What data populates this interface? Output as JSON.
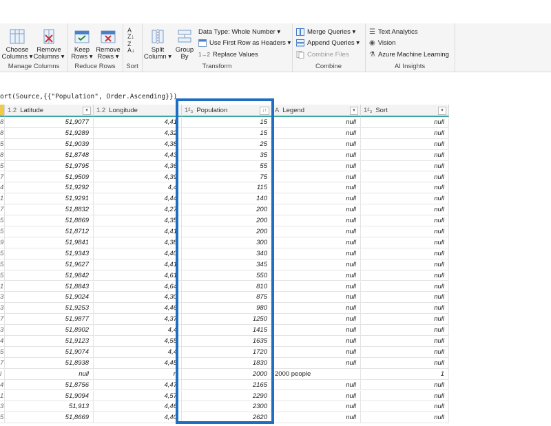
{
  "ribbon": {
    "manage_columns": {
      "label": "Manage Columns",
      "choose": [
        "Choose",
        "Columns ▾"
      ],
      "remove": [
        "Remove",
        "Columns ▾"
      ]
    },
    "reduce_rows": {
      "label": "Reduce Rows",
      "keep": [
        "Keep",
        "Rows ▾"
      ],
      "remove": [
        "Remove",
        "Rows ▾"
      ]
    },
    "sort": {
      "label": "Sort"
    },
    "transform": {
      "label": "Transform",
      "split": [
        "Split",
        "Column ▾"
      ],
      "group": [
        "Group",
        "By"
      ],
      "data_type": "Data Type: Whole Number ▾",
      "first_row": "Use First Row as Headers ▾",
      "replace": "Replace Values"
    },
    "combine": {
      "label": "Combine",
      "merge": "Merge Queries ▾",
      "append": "Append Queries ▾",
      "combine_files": "Combine Files"
    },
    "ai": {
      "label": "AI Insights",
      "text": "Text Analytics",
      "vision": "Vision",
      "azure": "Azure Machine Learning"
    }
  },
  "formula": "ort(Source,{{\"Population\", Order.Ascending}})",
  "columns": {
    "latitude": {
      "type": "1.2",
      "name": "Latitude"
    },
    "longitude": {
      "type": "1.2",
      "name": "Longitude"
    },
    "population": {
      "type": "1²₃",
      "name": "Population"
    },
    "legend": {
      "type": "A",
      "name": "Legend"
    },
    "sort": {
      "type": "1²₃",
      "name": "Sort"
    }
  },
  "rows": [
    {
      "idx": "8",
      "lat": "51,9077",
      "lon": "4,41",
      "pop": "15",
      "leg": "null",
      "sort": "null"
    },
    {
      "idx": "8",
      "lat": "51,9289",
      "lon": "4,32",
      "pop": "15",
      "leg": "null",
      "sort": "null"
    },
    {
      "idx": "5",
      "lat": "51,9039",
      "lon": "4,38",
      "pop": "25",
      "leg": "null",
      "sort": "null"
    },
    {
      "idx": "8",
      "lat": "51,8748",
      "lon": "4,43",
      "pop": "35",
      "leg": "null",
      "sort": "null"
    },
    {
      "idx": "5",
      "lat": "51,9795",
      "lon": "4,36",
      "pop": "55",
      "leg": "null",
      "sort": "null"
    },
    {
      "idx": "7",
      "lat": "51,9509",
      "lon": "4,39",
      "pop": "75",
      "leg": "null",
      "sort": "null"
    },
    {
      "idx": "4",
      "lat": "51,9292",
      "lon": "4,4",
      "pop": "115",
      "leg": "null",
      "sort": "null"
    },
    {
      "idx": "1",
      "lat": "51,9291",
      "lon": "4,44",
      "pop": "140",
      "leg": "null",
      "sort": "null"
    },
    {
      "idx": "7",
      "lat": "51,8832",
      "lon": "4,27",
      "pop": "200",
      "leg": "null",
      "sort": "null"
    },
    {
      "idx": "5",
      "lat": "51,8869",
      "lon": "4,35",
      "pop": "200",
      "leg": "null",
      "sort": "null"
    },
    {
      "idx": "5",
      "lat": "51,8712",
      "lon": "4,41",
      "pop": "200",
      "leg": "null",
      "sort": "null"
    },
    {
      "idx": "9",
      "lat": "51,9841",
      "lon": "4,38",
      "pop": "300",
      "leg": "null",
      "sort": "null"
    },
    {
      "idx": "5",
      "lat": "51,9343",
      "lon": "4,40",
      "pop": "340",
      "leg": "null",
      "sort": "null"
    },
    {
      "idx": "5",
      "lat": "51,9627",
      "lon": "4,41",
      "pop": "345",
      "leg": "null",
      "sort": "null"
    },
    {
      "idx": "5",
      "lat": "51,9842",
      "lon": "4,61",
      "pop": "550",
      "leg": "null",
      "sort": "null"
    },
    {
      "idx": "1",
      "lat": "51,8843",
      "lon": "4,64",
      "pop": "810",
      "leg": "null",
      "sort": "null"
    },
    {
      "idx": "3",
      "lat": "51,9024",
      "lon": "4,30",
      "pop": "875",
      "leg": "null",
      "sort": "null"
    },
    {
      "idx": "3",
      "lat": "51,9253",
      "lon": "4,46",
      "pop": "980",
      "leg": "null",
      "sort": "null"
    },
    {
      "idx": "7",
      "lat": "51,9877",
      "lon": "4,37",
      "pop": "1250",
      "leg": "null",
      "sort": "null"
    },
    {
      "idx": "3",
      "lat": "51,8902",
      "lon": "4,4",
      "pop": "1415",
      "leg": "null",
      "sort": "null"
    },
    {
      "idx": "4",
      "lat": "51,9123",
      "lon": "4,55",
      "pop": "1635",
      "leg": "null",
      "sort": "null"
    },
    {
      "idx": "5",
      "lat": "51,9074",
      "lon": "4,4",
      "pop": "1720",
      "leg": "null",
      "sort": "null"
    },
    {
      "idx": "7",
      "lat": "51,8938",
      "lon": "4,45",
      "pop": "1830",
      "leg": "null",
      "sort": "null"
    },
    {
      "idx": "l",
      "lat": "null",
      "lon": "n",
      "pop": "2000",
      "leg": "2000 people",
      "sort": "1"
    },
    {
      "idx": "4",
      "lat": "51,8756",
      "lon": "4,47",
      "pop": "2165",
      "leg": "null",
      "sort": "null"
    },
    {
      "idx": "1",
      "lat": "51,9094",
      "lon": "4,57",
      "pop": "2290",
      "leg": "null",
      "sort": "null"
    },
    {
      "idx": "3",
      "lat": "51,913",
      "lon": "4,46",
      "pop": "2300",
      "leg": "null",
      "sort": "null"
    },
    {
      "idx": "5",
      "lat": "51,8669",
      "lon": "4,40",
      "pop": "2620",
      "leg": "null",
      "sort": "null"
    }
  ]
}
